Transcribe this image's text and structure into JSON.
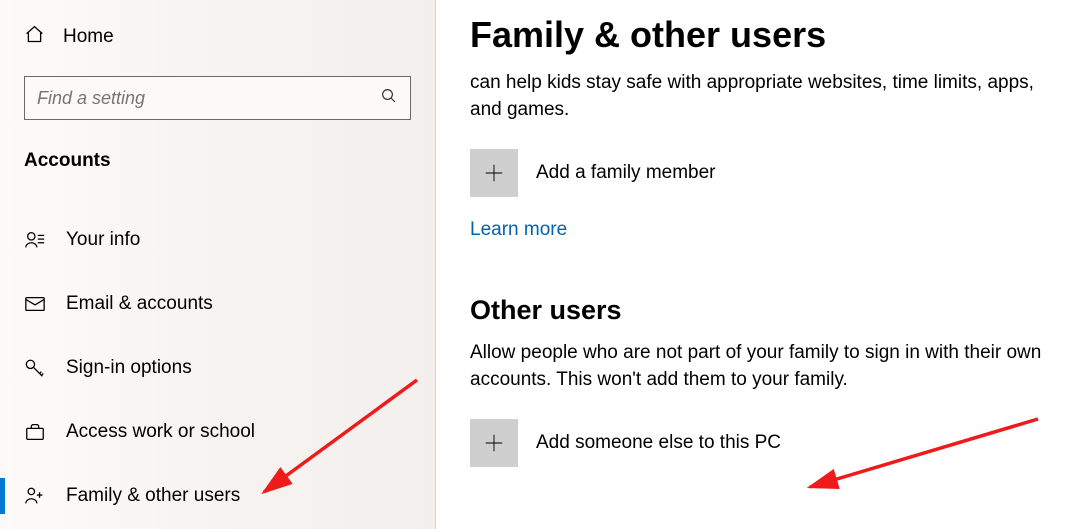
{
  "sidebar": {
    "home_label": "Home",
    "search_placeholder": "Find a setting",
    "section_heading": "Accounts",
    "items": [
      {
        "label": "Your info"
      },
      {
        "label": "Email & accounts"
      },
      {
        "label": "Sign-in options"
      },
      {
        "label": "Access work or school"
      },
      {
        "label": "Family & other users"
      }
    ]
  },
  "main": {
    "page_title": "Family & other users",
    "family_desc": "can help kids stay safe with appropriate websites, time limits, apps, and games.",
    "add_family_label": "Add a family member",
    "learn_more": "Learn more",
    "other_users_heading": "Other users",
    "other_users_desc": "Allow people who are not part of your family to sign in with their own accounts. This won't add them to your family.",
    "add_someone_label": "Add someone else to this PC"
  },
  "colors": {
    "accent": "#0078d4",
    "link": "#0063b1"
  }
}
